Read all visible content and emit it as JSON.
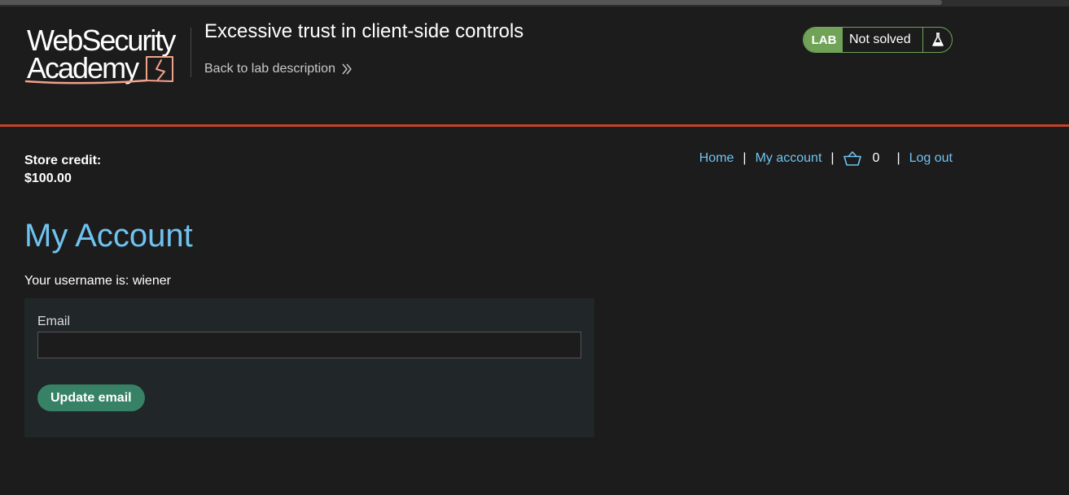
{
  "header": {
    "logo_line1": "WebSecurity",
    "logo_line2": "Academy",
    "lab_title": "Excessive trust in client-side controls",
    "back_link": "Back to lab description",
    "lab_badge": "LAB",
    "lab_status": "Not solved"
  },
  "account": {
    "store_credit_label": "Store credit:",
    "store_credit_value": "$100.00",
    "page_title": "My Account",
    "username_line": "Your username is: wiener",
    "email_label": "Email",
    "email_value": "",
    "update_button": "Update email"
  },
  "nav": {
    "home": "Home",
    "my_account": "My account",
    "separator": "|",
    "cart_count": "0",
    "log_out": "Log out"
  },
  "icons": {
    "back": "double-chevron-right-icon",
    "flask": "flask-icon",
    "cart": "basket-icon"
  },
  "colors": {
    "background": "#1c1c1c",
    "link": "#6fc3f0",
    "lab_green": "#70a358",
    "button_green": "#378266",
    "accent_rule": "#c2452a",
    "logo_accent": "#f0a28a"
  }
}
